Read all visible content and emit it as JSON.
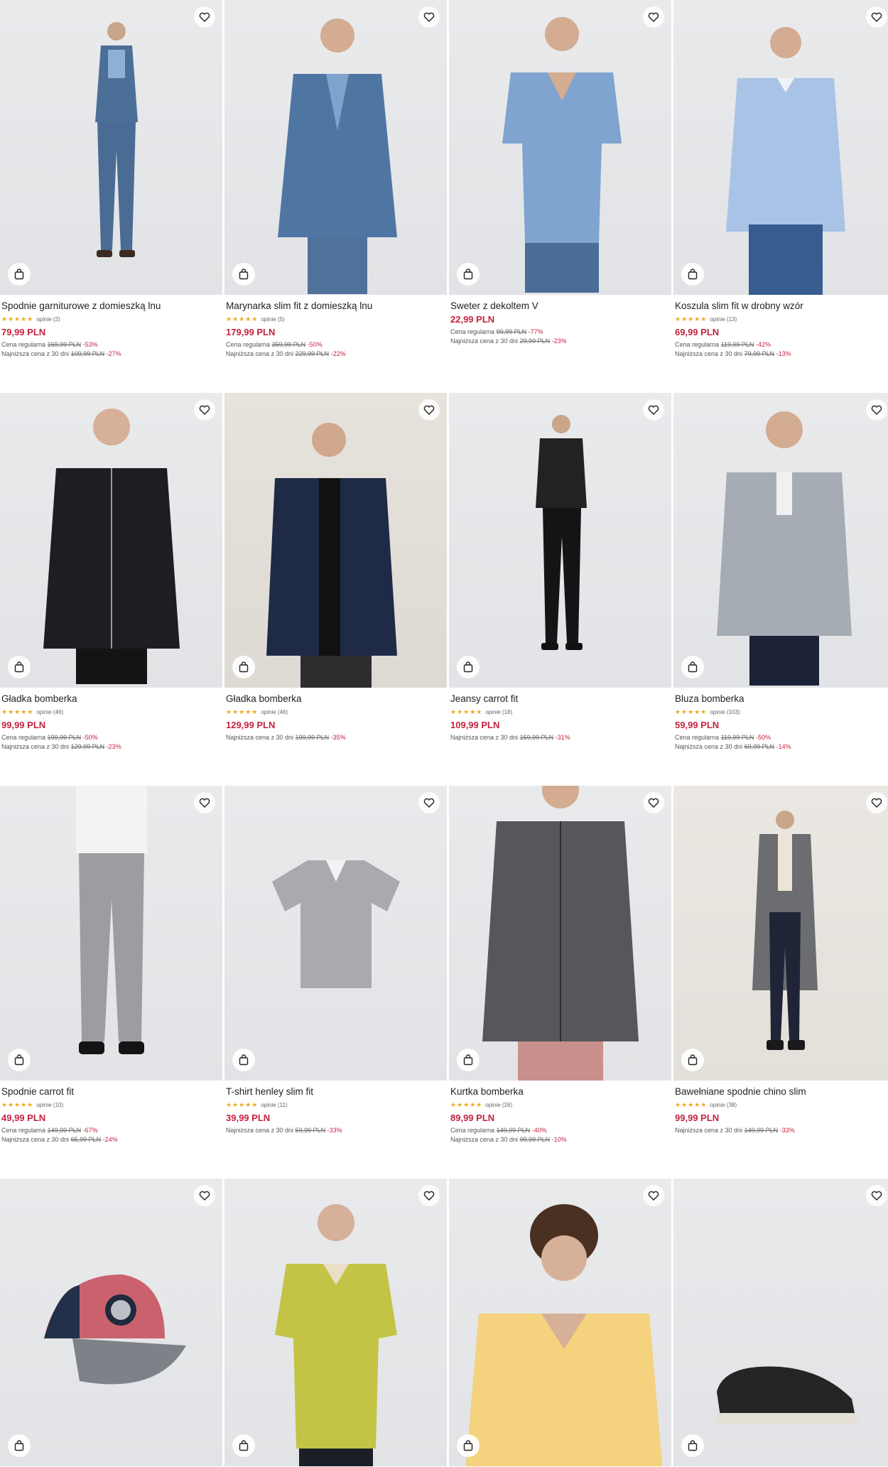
{
  "colors": {
    "price": "#c4233f",
    "stars": "#f0a81d",
    "photo_bg": "#e6e7ea"
  },
  "icons": {
    "favorite": "heart-icon",
    "cart": "shopping-bag-icon"
  },
  "products": [
    {
      "title": "Spodnie garniturowe z domieszką lnu",
      "stars": "★★★★★",
      "reviews": "opinie (2)",
      "price": "79,99 PLN",
      "regular_label": "Cena regularna",
      "regular_old": "169,99 PLN",
      "regular_pct": "-53%",
      "lowest_label": "Najniższa cena z 30 dni",
      "lowest_old": "109,99 PLN",
      "lowest_pct": "-27%"
    },
    {
      "title": "Marynarka slim fit z domieszką lnu",
      "stars": "★★★★★",
      "reviews": "opinie (5)",
      "price": "179,99 PLN",
      "regular_label": "Cena regularna",
      "regular_old": "359,99 PLN",
      "regular_pct": "-50%",
      "lowest_label": "Najniższa cena z 30 dni",
      "lowest_old": "229,99 PLN",
      "lowest_pct": "-22%"
    },
    {
      "title": "Sweter z dekoltem V",
      "price": "22,99 PLN",
      "regular_label": "Cena regularna",
      "regular_old": "99,99 PLN",
      "regular_pct": "-77%",
      "lowest_label": "Najniższa cena z 30 dni",
      "lowest_old": "29,99 PLN",
      "lowest_pct": "-23%"
    },
    {
      "title": "Koszula slim fit w drobny wzór",
      "stars": "★★★★★",
      "reviews": "opinie (13)",
      "price": "69,99 PLN",
      "regular_label": "Cena regularna",
      "regular_old": "119,99 PLN",
      "regular_pct": "-42%",
      "lowest_label": "Najniższa cena z 30 dni",
      "lowest_old": "79,99 PLN",
      "lowest_pct": "-13%"
    },
    {
      "title": "Gładka bomberka",
      "stars": "★★★★★",
      "reviews": "opinie (46)",
      "price": "99,99 PLN",
      "regular_label": "Cena regularna",
      "regular_old": "199,99 PLN",
      "regular_pct": "-50%",
      "lowest_label": "Najniższa cena z 30 dni",
      "lowest_old": "129,99 PLN",
      "lowest_pct": "-23%"
    },
    {
      "title": "Gładka bomberka",
      "stars": "★★★★★",
      "reviews": "opinie (46)",
      "price": "129,99 PLN",
      "lowest_label": "Najniższa cena z 30 dni",
      "lowest_old": "199,99 PLN",
      "lowest_pct": "-35%"
    },
    {
      "title": "Jeansy carrot fit",
      "stars": "★★★★★",
      "reviews": "opinie (18)",
      "price": "109,99 PLN",
      "lowest_label": "Najniższa cena z 30 dni",
      "lowest_old": "159,99 PLN",
      "lowest_pct": "-31%"
    },
    {
      "title": "Bluza bomberka",
      "stars": "★★★★★",
      "reviews": "opinie (103)",
      "price": "59,99 PLN",
      "regular_label": "Cena regularna",
      "regular_old": "119,99 PLN",
      "regular_pct": "-50%",
      "lowest_label": "Najniższa cena z 30 dni",
      "lowest_old": "69,99 PLN",
      "lowest_pct": "-14%"
    },
    {
      "title": "Spodnie carrot fit",
      "stars": "★★★★★",
      "reviews": "opinie (10)",
      "price": "49,99 PLN",
      "regular_label": "Cena regularna",
      "regular_old": "149,99 PLN",
      "regular_pct": "-67%",
      "lowest_label": "Najniższa cena z 30 dni",
      "lowest_old": "65,99 PLN",
      "lowest_pct": "-24%"
    },
    {
      "title": "T-shirt henley slim fit",
      "stars": "★★★★★",
      "reviews": "opinie (11)",
      "price": "39,99 PLN",
      "lowest_label": "Najniższa cena z 30 dni",
      "lowest_old": "59,99 PLN",
      "lowest_pct": "-33%"
    },
    {
      "title": "Kurtka bomberka",
      "stars": "★★★★★",
      "reviews": "opinie (26)",
      "price": "89,99 PLN",
      "regular_label": "Cena regularna",
      "regular_old": "149,99 PLN",
      "regular_pct": "-40%",
      "lowest_label": "Najniższa cena z 30 dni",
      "lowest_old": "99,99 PLN",
      "lowest_pct": "-10%"
    },
    {
      "title": "Bawełniane spodnie chino slim",
      "stars": "★★★★★",
      "reviews": "opinie (38)",
      "price": "99,99 PLN",
      "lowest_label": "Najniższa cena z 30 dni",
      "lowest_old": "149,99 PLN",
      "lowest_pct": "-33%"
    },
    {
      "title": "",
      "price": ""
    },
    {
      "title": "",
      "price": ""
    },
    {
      "title": "",
      "price": ""
    },
    {
      "title": "",
      "price": ""
    }
  ]
}
